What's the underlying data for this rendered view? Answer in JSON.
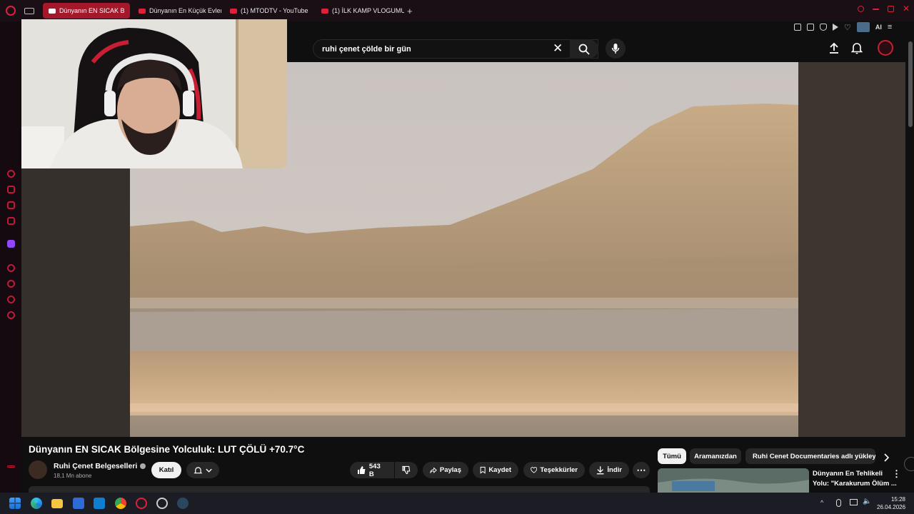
{
  "browser": {
    "tabs": [
      {
        "label": "Dünyanın EN SICAK B",
        "active": true
      },
      {
        "label": "Dünyanın En Küçük Evleri",
        "active": false
      },
      {
        "label": "(1) MTODTV - YouTube",
        "active": false
      },
      {
        "label": "(1) İLK KAMP VLOGUMUZ",
        "active": false
      }
    ],
    "new_tab": "+",
    "ai_label": "AI"
  },
  "youtube": {
    "search": {
      "value": "ruhi çenet çölde bir gün",
      "clear_icon": "close-icon",
      "search_icon": "search-icon",
      "mic_icon": "mic-icon"
    },
    "video": {
      "title": "Dünyanın EN SICAK Bölgesine Yolculuk: LUT ÇÖLÜ +70.7°C",
      "channel": "Ruhi Çenet Belgeselleri",
      "subscribers": "18,1 Mn abone",
      "join": "Katıl",
      "likes": "543 B",
      "share": "Paylaş",
      "save": "Kaydet",
      "thanks": "Teşekkürler",
      "download": "İndir"
    },
    "chips": [
      "Tümü",
      "Aramanızdan",
      "Ruhi Cenet Documentaries adlı yükleyicid"
    ],
    "recommended": {
      "title_line1": "Dünyanın En Tehlikeli",
      "title_line2": "Yolu: \"Karakurum Ölüm ..."
    }
  },
  "taskbar": {
    "time": "15:28",
    "date": "26.04.2026"
  },
  "colors": {
    "accent": "#e0203a",
    "bg": "#0f0f0f",
    "chip_active": "#f1f1f1"
  }
}
